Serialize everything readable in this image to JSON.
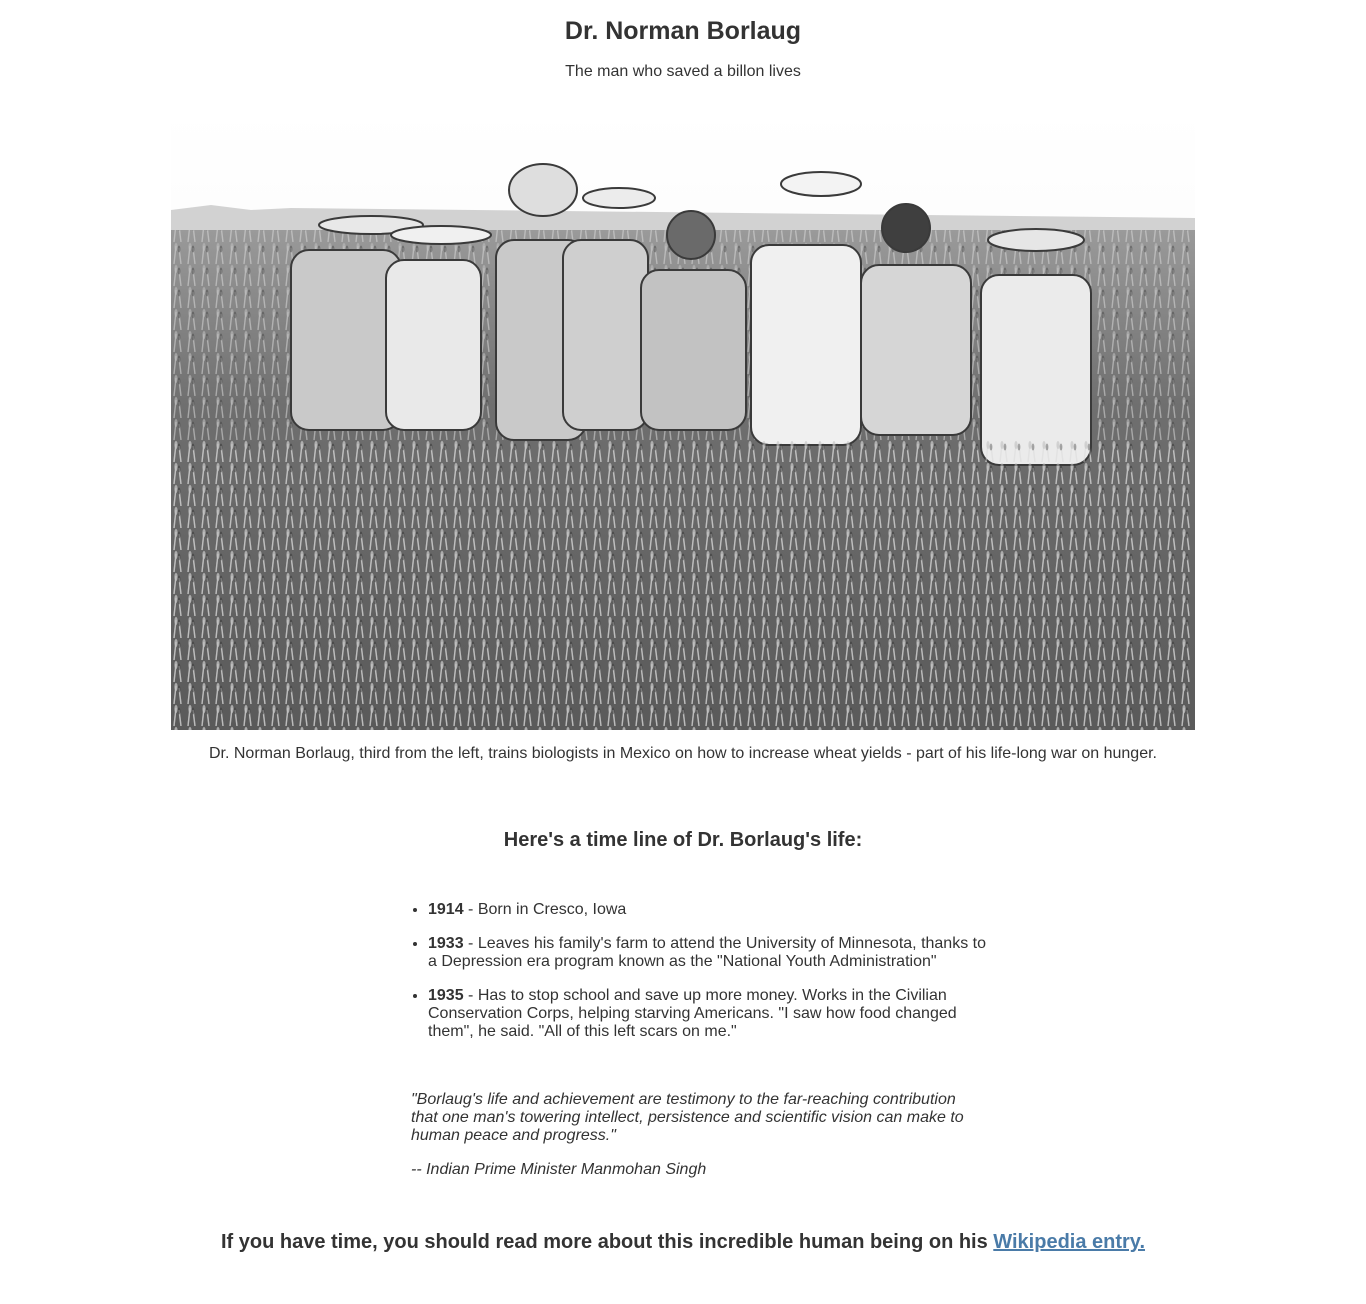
{
  "header": {
    "title": "Dr. Norman Borlaug",
    "subtitle": "The man who saved a billon lives"
  },
  "photo": {
    "caption": "Dr. Norman Borlaug, third from the left, trains biologists in Mexico on how to increase wheat yields - part of his life-long war on hunger."
  },
  "timeline": {
    "heading": "Here's a time line of Dr. Borlaug's life:",
    "items": [
      {
        "year": "1914",
        "text": " - Born in Cresco, Iowa"
      },
      {
        "year": "1933",
        "text": " - Leaves his family's farm to attend the University of Minnesota, thanks to a Depression era program known as the \"National Youth Administration\""
      },
      {
        "year": "1935",
        "text": " - Has to stop school and save up more money. Works in the Civilian Conservation Corps, helping starving Americans. \"I saw how food changed them\", he said. \"All of this left scars on me.\""
      }
    ]
  },
  "quote": {
    "text": "\"Borlaug's life and achievement are testimony to the far-reaching contribution that one man's towering intellect, persistence and scientific vision can make to human peace and progress.\"",
    "attribution": "-- Indian Prime Minister Manmohan Singh"
  },
  "outro": {
    "text": "If you have time, you should read more about this incredible human being on his ",
    "link_label": "Wikipedia entry."
  }
}
